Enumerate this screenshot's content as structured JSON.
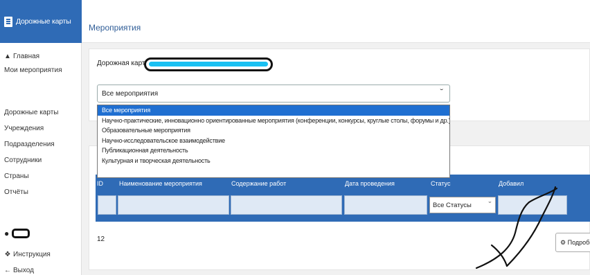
{
  "brand": {
    "label": "Дорожные карты"
  },
  "sidebar": {
    "home": "Главная",
    "my_events": "Мои мероприятия",
    "items": [
      "Дорожные карты",
      "Учреждения",
      "Подразделения",
      "Сотрудники",
      "Страны",
      "Отчёты"
    ],
    "instruction": "Инструкция",
    "logout": "Выход"
  },
  "header": {
    "title": "Мероприятия"
  },
  "roadmap": {
    "label": "Дорожная карта"
  },
  "event_select": {
    "value": "Все мероприятия",
    "options": [
      "Все мероприятия",
      "Научно-практические, инновационно ориентированные мероприятия (конференции, конкурсы, круглые столы, форумы и др.)",
      "Образовательные мероприятия",
      "Научно-исследовательское взаимодействие",
      "Публикационная деятельность",
      "Культурная и творческая деятельность"
    ]
  },
  "table": {
    "columns": [
      "ID",
      "Наименование мероприятия",
      "Содержание работ",
      "Дата проведения",
      "Статус",
      "Добавил"
    ],
    "status_filter": "Все Статусы",
    "row_count": "12",
    "more_button": "Подробно"
  },
  "colors": {
    "primary": "#2f6bb6",
    "selected": "#1f6fd1",
    "redaction_fill": "#19c0f2"
  }
}
